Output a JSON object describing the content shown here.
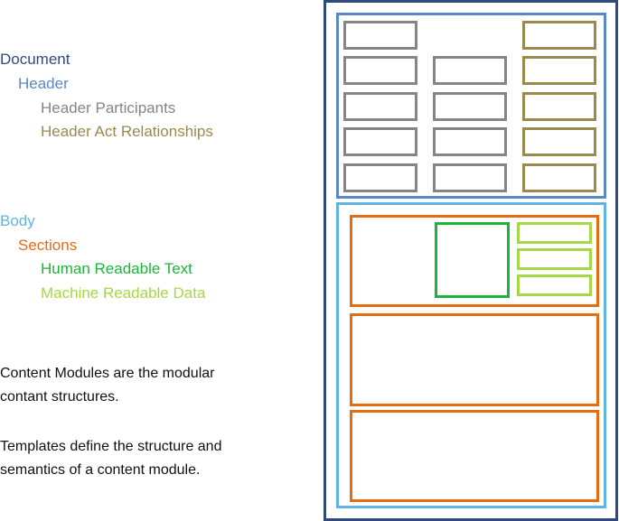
{
  "colors": {
    "document": "#2e4a7e",
    "header": "#5b87c6",
    "header_participants": "#858585",
    "header_act_relationships": "#9a8a4e",
    "body": "#61b4e2",
    "sections": "#e66c12",
    "human_readable_text": "#1eb43c",
    "machine_readable_data": "#a6d845",
    "note_text": "#111111"
  },
  "legend": {
    "document": "Document",
    "header": "Header",
    "header_participants": "Header Participants",
    "header_act_relationships": "Header Act Relationships",
    "body": "Body",
    "sections": "Sections",
    "human_readable_text": "Human Readable Text",
    "machine_readable_data": "Machine Readable Data"
  },
  "notes": {
    "content_modules": [
      "Content Modules are the modular",
      "contant structures."
    ],
    "templates": [
      "Templates define the structure and",
      "semantics of a content module."
    ]
  },
  "diagram": {
    "header": {
      "participant_count": 9,
      "act_relationship_count": 5
    },
    "body": {
      "section_count": 3,
      "first_section": {
        "human_readable_text_count": 1,
        "machine_readable_data_count": 3
      }
    }
  }
}
